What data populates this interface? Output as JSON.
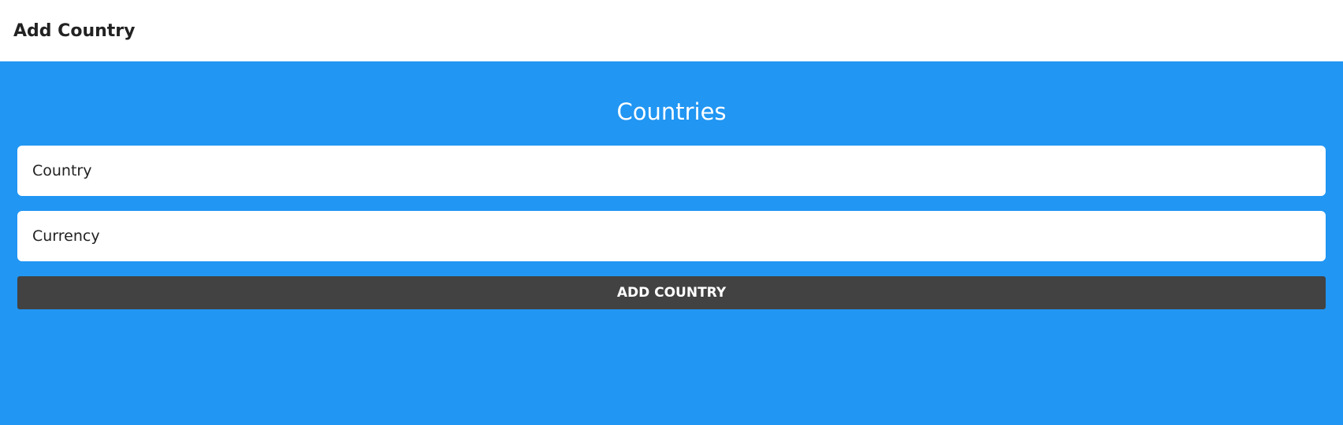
{
  "header": {
    "title": "Add Country"
  },
  "main": {
    "heading": "Countries",
    "country_field": {
      "placeholder": "Country",
      "value": ""
    },
    "currency_field": {
      "placeholder": "Currency",
      "value": ""
    },
    "add_button_label": "ADD COUNTRY"
  },
  "colors": {
    "header_bg": "#ffffff",
    "main_bg": "#2196f3",
    "button_bg": "#424242"
  }
}
